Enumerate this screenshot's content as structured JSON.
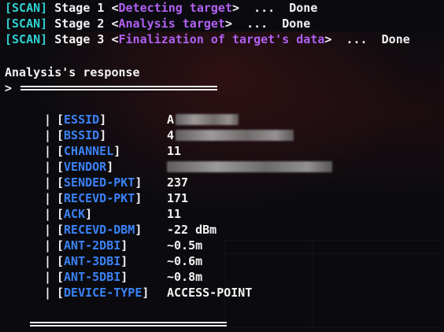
{
  "scan_lines": [
    {
      "tag": "[SCAN]",
      "stage": "Stage 1",
      "task": "Detecting target",
      "dots": "...",
      "status": "Done"
    },
    {
      "tag": "[SCAN]",
      "stage": "Stage 2",
      "task": "Analysis target",
      "dots": "...",
      "status": "Done"
    },
    {
      "tag": "[SCAN]",
      "stage": "Stage 3",
      "task": "Finalization of target's data",
      "dots": "...",
      "status": "Done"
    }
  ],
  "response": {
    "title": "Analysis's response",
    "prompt": ">"
  },
  "fields": [
    {
      "key": "ESSID",
      "value": "A"
    },
    {
      "key": "BSSID",
      "value": "4"
    },
    {
      "key": "CHANNEL",
      "value": "11"
    },
    {
      "key": "VENDOR",
      "value": ""
    },
    {
      "key": "SENDED-PKT",
      "value": "237"
    },
    {
      "key": "RECEVD-PKT",
      "value": "171"
    },
    {
      "key": "ACK",
      "value": "11"
    },
    {
      "key": "RECEVD-DBM",
      "value": "-22 dBm"
    },
    {
      "key": "ANT-2DBI",
      "value": "~0.5m"
    },
    {
      "key": "ANT-3DBI",
      "value": "~0.6m"
    },
    {
      "key": "ANT-5DBI",
      "value": "~0.8m"
    },
    {
      "key": "DEVICE-TYPE",
      "value": "ACCESS-POINT"
    }
  ],
  "colors": {
    "tag": "#30d2d2",
    "task": "#b060f2",
    "key": "#3b82f6",
    "text": "#f3f3f3",
    "background": "#0b0b0f"
  }
}
